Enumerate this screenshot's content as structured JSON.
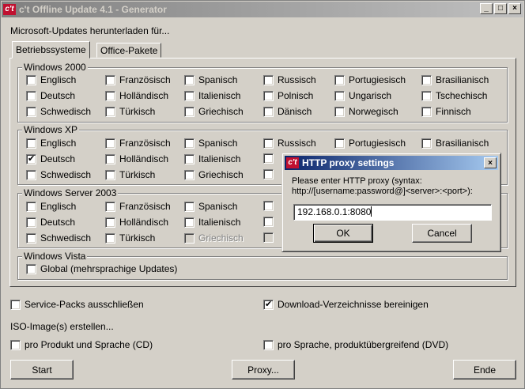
{
  "window": {
    "logo": "c't",
    "title": "c't Offline Update 4.1 - Generator",
    "minimize": "_",
    "maximize": "□",
    "close": "×"
  },
  "intro_label": "Microsoft-Updates herunterladen für...",
  "tabs": [
    {
      "label": "Betriebssysteme",
      "active": true
    },
    {
      "label": "Office-Pakete",
      "active": false
    }
  ],
  "groups": {
    "win2000": {
      "title": "Windows 2000",
      "rows": [
        [
          "Englisch",
          "Französisch",
          "Spanisch",
          "Russisch",
          "Portugiesisch",
          "Brasilianisch"
        ],
        [
          "Deutsch",
          "Holländisch",
          "Italienisch",
          "Polnisch",
          "Ungarisch",
          "Tschechisch"
        ],
        [
          "Schwedisch",
          "Türkisch",
          "Griechisch",
          "Dänisch",
          "Norwegisch",
          "Finnisch"
        ]
      ]
    },
    "winxp": {
      "title": "Windows XP",
      "rows": [
        [
          "Englisch",
          "Französisch",
          "Spanisch",
          "Russisch",
          "Portugiesisch",
          "Brasilianisch"
        ],
        [
          "Deutsch",
          "Holländisch",
          "Italienisch"
        ],
        [
          "Schwedisch",
          "Türkisch",
          "Griechisch"
        ]
      ],
      "checked": "Deutsch"
    },
    "win2003": {
      "title": "Windows Server 2003",
      "rows": [
        [
          "Englisch",
          "Französisch",
          "Spanisch"
        ],
        [
          "Deutsch",
          "Holländisch",
          "Italienisch"
        ],
        [
          "Schwedisch",
          "Türkisch",
          "Griechisch"
        ]
      ],
      "disabled": "Griechisch"
    },
    "vista": {
      "title": "Windows Vista",
      "global": "Global (mehrsprachige Updates)"
    }
  },
  "options": {
    "exclude_sp": "Service-Packs ausschließen",
    "cleanup_dirs": "Download-Verzeichnisse bereinigen",
    "cleanup_checked": true,
    "iso_label": "ISO-Image(s) erstellen...",
    "iso_per_product": "pro Produkt und Sprache (CD)",
    "iso_per_language": "pro Sprache, produktübergreifend (DVD)"
  },
  "buttons": {
    "start": "Start",
    "proxy": "Proxy...",
    "end": "Ende"
  },
  "dialog": {
    "logo": "c't",
    "title": "HTTP proxy settings",
    "close": "×",
    "message": "Please enter HTTP proxy (syntax:\nhttp://[username:password@]<server>:<port>):",
    "value": "192.168.0.1:8080",
    "ok": "OK",
    "cancel": "Cancel"
  }
}
